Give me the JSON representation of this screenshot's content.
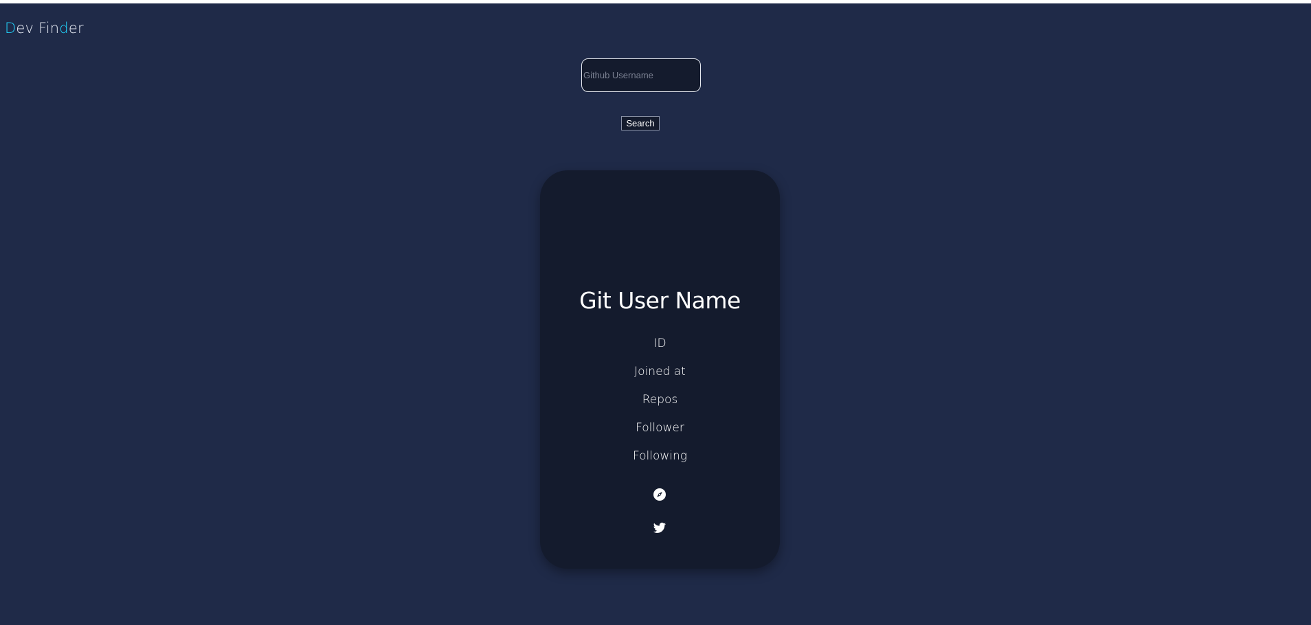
{
  "app": {
    "logo_first_letter": "D",
    "logo_middle": "ev Fin",
    "logo_accent_letter": "d",
    "logo_end": "er",
    "accent_color": "#21d4fd",
    "background_color": "#1f2a48",
    "card_color": "#141b2d"
  },
  "search": {
    "placeholder": "Github Username",
    "value": "",
    "button_label": "Search"
  },
  "profile": {
    "name": "Git User Name",
    "id_label": "ID",
    "joined_label": "Joined at",
    "repos_label": "Repos",
    "follower_label": "Follower",
    "following_label": "Following",
    "icons": [
      "compass-icon",
      "twitter-icon"
    ]
  }
}
